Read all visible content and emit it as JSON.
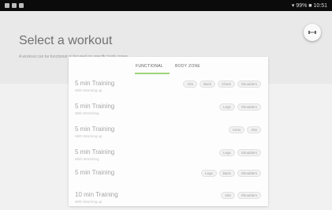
{
  "status_bar": {
    "right_text": "▾ 99% ■ 10:51"
  },
  "header": {
    "title": "Select a workout",
    "subtitle": "A workout can be functional or focused on specific body zones"
  },
  "fab": {
    "icon": "dumbbell-icon",
    "label": "◆"
  },
  "tabs": [
    {
      "label": "FUNCTIONAL",
      "selected": true
    },
    {
      "label": "BODY ZONE",
      "selected": false
    }
  ],
  "accent_color": "#9fd27a",
  "workouts": [
    {
      "title": "5 min Training",
      "subtitle": "With Warming up",
      "tags": [
        "Abs",
        "Back",
        "Chest",
        "Shoulders"
      ]
    },
    {
      "title": "5 min Training",
      "subtitle": "With Stretching",
      "tags": [
        "Legs",
        "Shoulders"
      ]
    },
    {
      "title": "5 min Training",
      "subtitle": "With Warming up",
      "tags": [
        "Arms",
        "Abs"
      ]
    },
    {
      "title": "5 min Training",
      "subtitle": "With Stretching",
      "tags": [
        "Legs",
        "Shoulders"
      ]
    },
    {
      "title": "5 min Training",
      "subtitle": "",
      "tags": [
        "Legs",
        "Back",
        "Shoulders"
      ]
    },
    {
      "title": "10 min Training",
      "subtitle": "With Warming up",
      "tags": [
        "Abs",
        "Shoulders"
      ]
    }
  ]
}
